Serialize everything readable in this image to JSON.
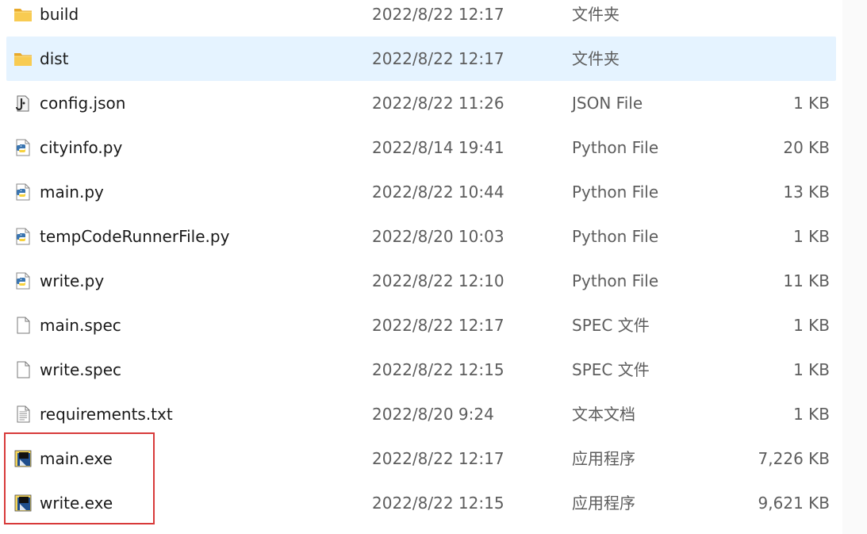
{
  "files": [
    {
      "name": "build",
      "date": "2022/8/22 12:17",
      "type": "文件夹",
      "size": "",
      "icon": "folder-icon",
      "selected": false
    },
    {
      "name": "dist",
      "date": "2022/8/22 12:17",
      "type": "文件夹",
      "size": "",
      "icon": "folder-icon",
      "selected": true
    },
    {
      "name": "config.json",
      "date": "2022/8/22 11:26",
      "type": "JSON File",
      "size": "1 KB",
      "icon": "json-file-icon",
      "selected": false
    },
    {
      "name": "cityinfo.py",
      "date": "2022/8/14 19:41",
      "type": "Python File",
      "size": "20 KB",
      "icon": "python-file-icon",
      "selected": false
    },
    {
      "name": "main.py",
      "date": "2022/8/22 10:44",
      "type": "Python File",
      "size": "13 KB",
      "icon": "python-file-icon",
      "selected": false
    },
    {
      "name": "tempCodeRunnerFile.py",
      "date": "2022/8/20 10:03",
      "type": "Python File",
      "size": "1 KB",
      "icon": "python-file-icon",
      "selected": false
    },
    {
      "name": "write.py",
      "date": "2022/8/22 12:10",
      "type": "Python File",
      "size": "11 KB",
      "icon": "python-file-icon",
      "selected": false
    },
    {
      "name": "main.spec",
      "date": "2022/8/22 12:17",
      "type": "SPEC 文件",
      "size": "1 KB",
      "icon": "blank-file-icon",
      "selected": false
    },
    {
      "name": "write.spec",
      "date": "2022/8/22 12:15",
      "type": "SPEC 文件",
      "size": "1 KB",
      "icon": "blank-file-icon",
      "selected": false
    },
    {
      "name": "requirements.txt",
      "date": "2022/8/20 9:24",
      "type": "文本文档",
      "size": "1 KB",
      "icon": "text-file-icon",
      "selected": false
    },
    {
      "name": "main.exe",
      "date": "2022/8/22 12:17",
      "type": "应用程序",
      "size": "7,226 KB",
      "icon": "pyinstaller-exe-icon",
      "selected": false
    },
    {
      "name": "write.exe",
      "date": "2022/8/22 12:15",
      "type": "应用程序",
      "size": "9,621 KB",
      "icon": "pyinstaller-exe-icon",
      "selected": false
    }
  ],
  "colors": {
    "selection": "#e5f3ff",
    "highlight_border": "#d83a3a",
    "folder": "#f6c343",
    "secondary_text": "#5d5d5d"
  }
}
